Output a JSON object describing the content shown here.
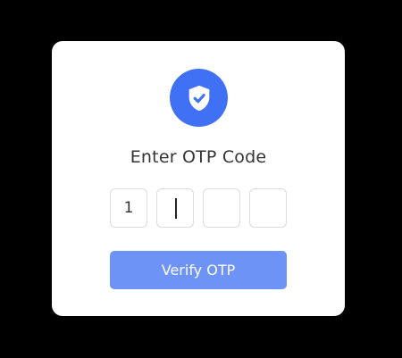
{
  "colors": {
    "page_background": "#000000",
    "card_background": "#ffffff",
    "accent": "#4070f4",
    "button_background": "#6e93f7",
    "title_text": "#333333",
    "input_border": "#dddddd"
  },
  "header": {
    "icon": "shield-check-icon",
    "title": "Enter OTP Code"
  },
  "otp": {
    "digits": [
      "1",
      "",
      "",
      ""
    ],
    "focused_index": 1
  },
  "actions": {
    "verify_label": "Verify OTP"
  }
}
